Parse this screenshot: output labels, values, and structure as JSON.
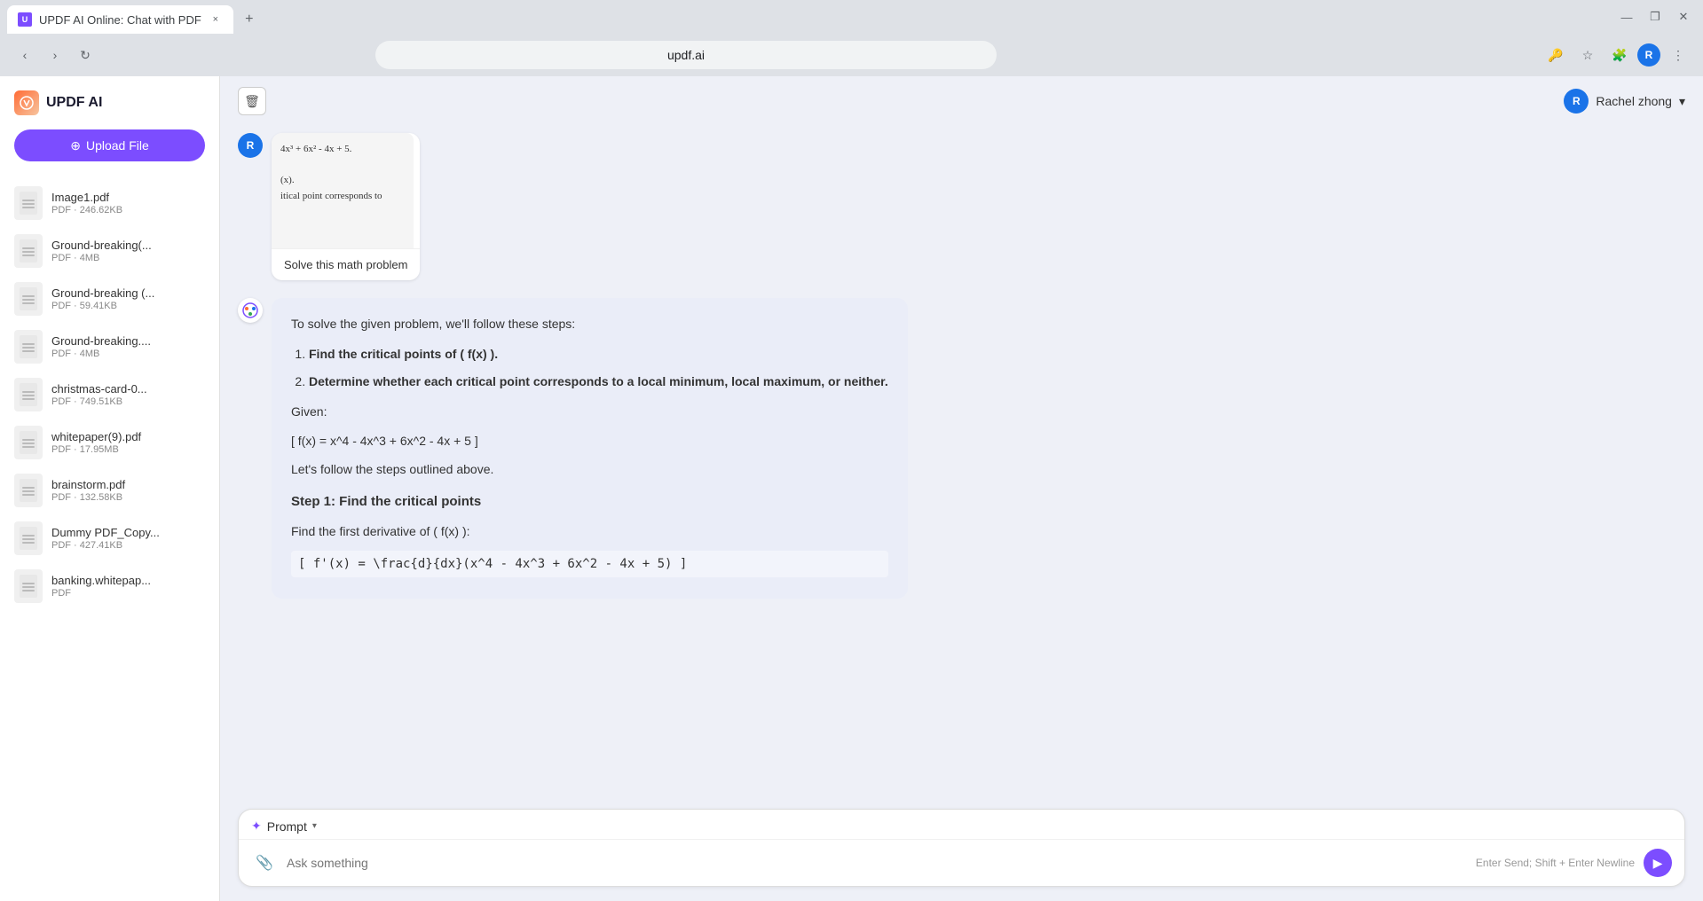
{
  "browser": {
    "tab": {
      "title": "UPDF AI Online: Chat with PDF",
      "favicon": "U",
      "close": "×",
      "new_tab": "+"
    },
    "url": "updf.ai",
    "window_controls": {
      "minimize": "—",
      "maximize": "❐",
      "close": "✕"
    }
  },
  "sidebar": {
    "title": "UPDF AI",
    "upload_button": "Upload File",
    "files": [
      {
        "name": "Image1.pdf",
        "size": "PDF · 246.62KB"
      },
      {
        "name": "Ground-breaking(...",
        "size": "PDF · 4MB"
      },
      {
        "name": "Ground-breaking (...",
        "size": "PDF · 59.41KB"
      },
      {
        "name": "Ground-breaking....",
        "size": "PDF · 4MB"
      },
      {
        "name": "christmas-card-0...",
        "size": "PDF · 749.51KB"
      },
      {
        "name": "whitepaper(9).pdf",
        "size": "PDF · 17.95MB"
      },
      {
        "name": "brainstorm.pdf",
        "size": "PDF · 132.58KB"
      },
      {
        "name": "Dummy PDF_Copy...",
        "size": "PDF · 427.41KB"
      },
      {
        "name": "banking.whitepap...",
        "size": "PDF"
      }
    ]
  },
  "header": {
    "user_name": "Rachel zhong",
    "user_initial": "R"
  },
  "user_message": {
    "avatar_initial": "R",
    "math_preview_line1": "4x³ + 6x² - 4x + 5.",
    "math_preview_line2": "(x).",
    "math_preview_line3": "itical point corresponds to",
    "message_text": "Solve this math problem"
  },
  "ai_response": {
    "intro": "To solve the given problem, we'll follow these steps:",
    "steps": [
      "Find the critical points of ( f(x) ).",
      "Determine whether each critical point corresponds to a local minimum, local maximum, or neither."
    ],
    "given_label": "Given:",
    "given_formula": "[ f(x) = x^4 - 4x^3 + 6x^2 - 4x + 5 ]",
    "follow_text": "Let's follow the steps outlined above.",
    "step1_title": "Step 1: Find the critical points",
    "step1_text": "Find the first derivative of ( f(x) ):",
    "step1_formula": "[ f'(x) = \\frac{d}{dx}(x^4 - 4x^3 + 6x^2 - 4x + 5) ]"
  },
  "input": {
    "prompt_label": "Prompt",
    "prompt_chevron": "▾",
    "placeholder": "Ask something",
    "hint": "Enter Send; Shift + Enter Newline",
    "send_icon": "➤"
  }
}
